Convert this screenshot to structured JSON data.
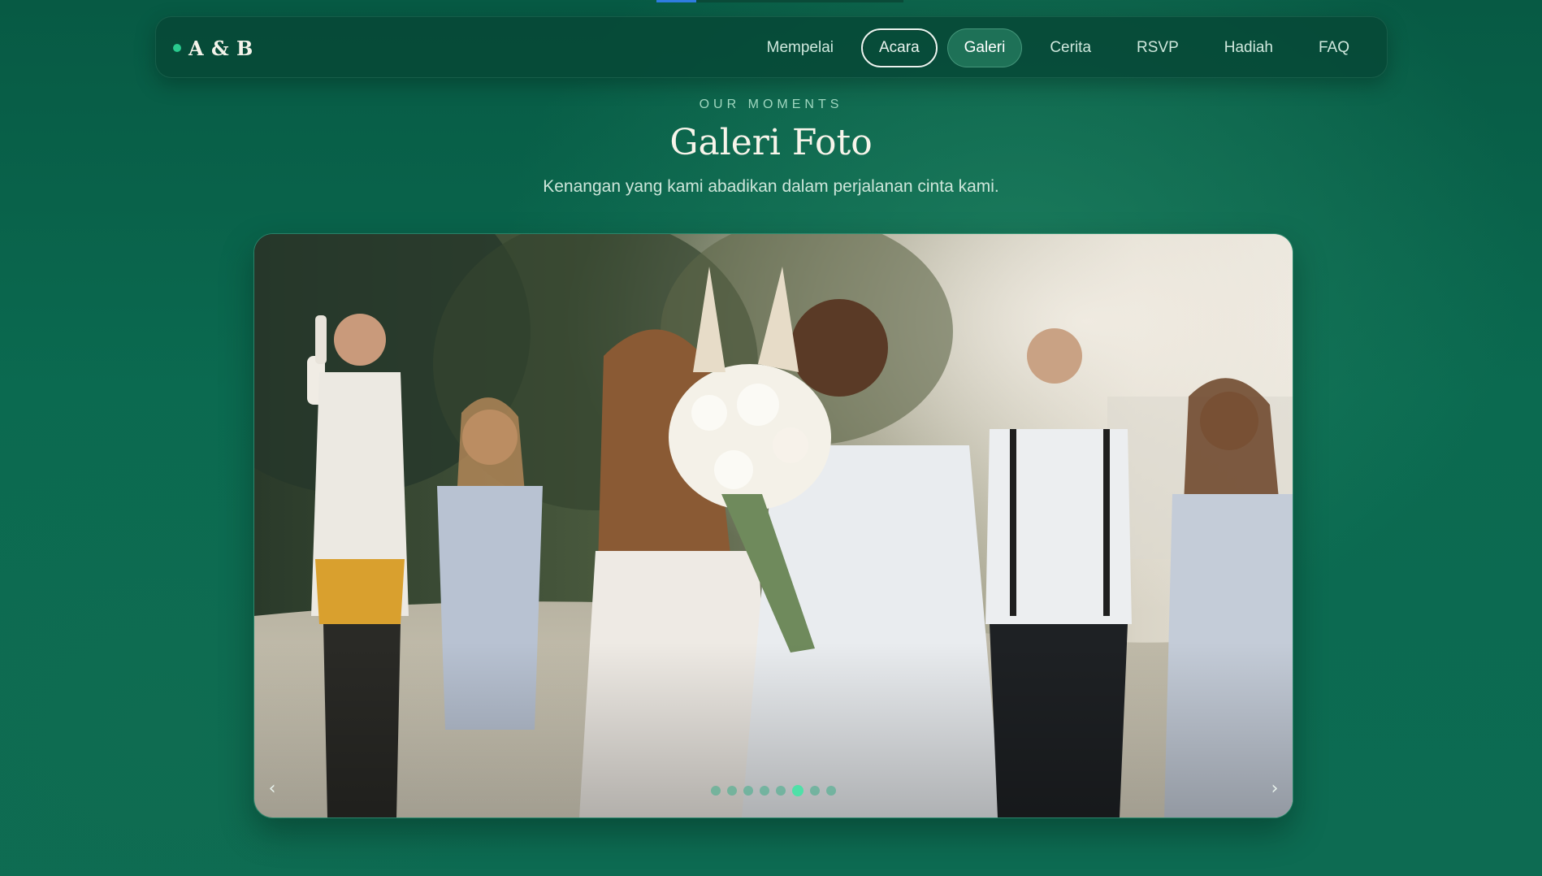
{
  "top_progress": {
    "value": 0.16
  },
  "brand": {
    "text": "A & B"
  },
  "nav": {
    "items": [
      {
        "label": "Mempelai",
        "state": "normal"
      },
      {
        "label": "Acara",
        "state": "focused"
      },
      {
        "label": "Galeri",
        "state": "active"
      },
      {
        "label": "Cerita",
        "state": "normal"
      },
      {
        "label": "RSVP",
        "state": "normal"
      },
      {
        "label": "Hadiah",
        "state": "normal"
      },
      {
        "label": "FAQ",
        "state": "normal"
      }
    ]
  },
  "gallery": {
    "eyebrow": "OUR MOMENTS",
    "title": "Galeri Foto",
    "subtitle": "Kenangan yang kami abadikan dalam perjalanan cinta kami.",
    "prev_label": "‹",
    "next_label": "›",
    "slide_count": 8,
    "active_slide": 6
  },
  "colors": {
    "accent": "#29c98d",
    "background": "#0b6a50",
    "dot_active": "#4fe0a8"
  },
  "icons": {
    "prev": "chevron-left-icon",
    "next": "chevron-right-icon",
    "brand_dot": "dot-icon"
  }
}
